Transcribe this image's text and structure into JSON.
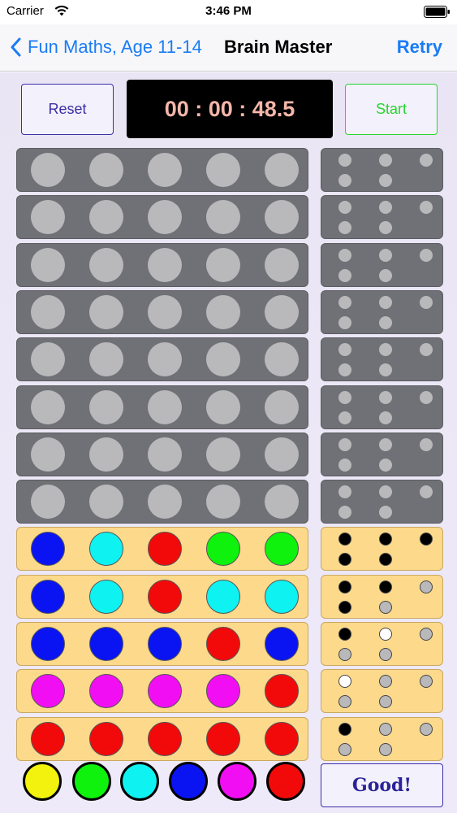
{
  "status_bar": {
    "carrier": "Carrier",
    "time": "3:46 PM"
  },
  "nav": {
    "back_label": "Fun Maths, Age 11-14",
    "title": "Brain Master",
    "retry_label": "Retry"
  },
  "controls": {
    "reset_label": "Reset",
    "timer": "00 : 00 : 48.5",
    "start_label": "Start",
    "good_label": "Good!"
  },
  "colors": {
    "accent": "#1a7cf5",
    "empty": "#b9b9bb",
    "blue": "#0a14f2",
    "cyan": "#0ef2f2",
    "red": "#f20a0a",
    "green": "#0ef20e",
    "magenta": "#f20ef2",
    "yellow": "#f2f20e",
    "black": "#000000",
    "white": "#ffffff"
  },
  "guess_rows": [
    {
      "pegs": [
        "empty",
        "empty",
        "empty",
        "empty",
        "empty"
      ],
      "feedback": [
        "empty",
        "empty",
        "empty",
        "empty",
        "empty"
      ]
    },
    {
      "pegs": [
        "empty",
        "empty",
        "empty",
        "empty",
        "empty"
      ],
      "feedback": [
        "empty",
        "empty",
        "empty",
        "empty",
        "empty"
      ]
    },
    {
      "pegs": [
        "empty",
        "empty",
        "empty",
        "empty",
        "empty"
      ],
      "feedback": [
        "empty",
        "empty",
        "empty",
        "empty",
        "empty"
      ]
    },
    {
      "pegs": [
        "empty",
        "empty",
        "empty",
        "empty",
        "empty"
      ],
      "feedback": [
        "empty",
        "empty",
        "empty",
        "empty",
        "empty"
      ]
    },
    {
      "pegs": [
        "empty",
        "empty",
        "empty",
        "empty",
        "empty"
      ],
      "feedback": [
        "empty",
        "empty",
        "empty",
        "empty",
        "empty"
      ]
    },
    {
      "pegs": [
        "empty",
        "empty",
        "empty",
        "empty",
        "empty"
      ],
      "feedback": [
        "empty",
        "empty",
        "empty",
        "empty",
        "empty"
      ]
    },
    {
      "pegs": [
        "empty",
        "empty",
        "empty",
        "empty",
        "empty"
      ],
      "feedback": [
        "empty",
        "empty",
        "empty",
        "empty",
        "empty"
      ]
    },
    {
      "pegs": [
        "empty",
        "empty",
        "empty",
        "empty",
        "empty"
      ],
      "feedback": [
        "empty",
        "empty",
        "empty",
        "empty",
        "empty"
      ]
    },
    {
      "pegs": [
        "blue",
        "cyan",
        "red",
        "green",
        "green"
      ],
      "feedback": [
        "black",
        "black",
        "black",
        "black",
        "black"
      ]
    },
    {
      "pegs": [
        "blue",
        "cyan",
        "red",
        "cyan",
        "cyan"
      ],
      "feedback": [
        "black",
        "black",
        "empty",
        "black",
        "empty"
      ]
    },
    {
      "pegs": [
        "blue",
        "blue",
        "blue",
        "red",
        "blue"
      ],
      "feedback": [
        "black",
        "white",
        "empty",
        "empty",
        "empty"
      ]
    },
    {
      "pegs": [
        "magenta",
        "magenta",
        "magenta",
        "magenta",
        "red"
      ],
      "feedback": [
        "white",
        "empty",
        "empty",
        "empty",
        "empty"
      ]
    },
    {
      "pegs": [
        "red",
        "red",
        "red",
        "red",
        "red"
      ],
      "feedback": [
        "black",
        "empty",
        "empty",
        "empty",
        "empty"
      ]
    }
  ],
  "palette": [
    "yellow",
    "green",
    "cyan",
    "blue",
    "magenta",
    "red"
  ]
}
